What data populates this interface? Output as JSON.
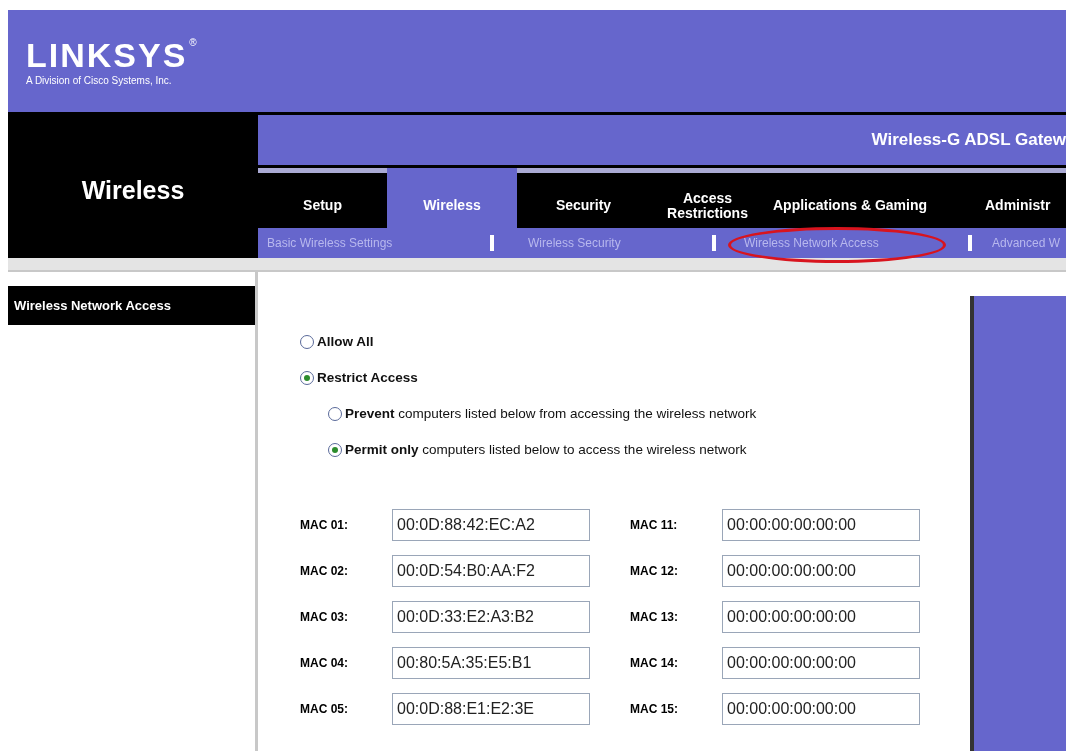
{
  "logo": {
    "brand": "LINKSYS",
    "mark": "®",
    "tagline": "A Division of Cisco Systems, Inc."
  },
  "section_title": "Wireless",
  "product_name": "Wireless-G ADSL Gatew",
  "tabs": [
    {
      "label": "Setup",
      "selected": false
    },
    {
      "label": "Wireless",
      "selected": true
    },
    {
      "label": "Security",
      "selected": false
    },
    {
      "label": "Access Restrictions",
      "selected": false
    },
    {
      "label": "Applications & Gaming",
      "selected": false
    },
    {
      "label": "Administr",
      "selected": false
    }
  ],
  "sub_tabs": [
    {
      "label": "Basic Wireless Settings",
      "circled": false
    },
    {
      "label": "Wireless Security",
      "circled": false
    },
    {
      "label": "Wireless Network Access",
      "circled": true
    },
    {
      "label": "Advanced W",
      "circled": false
    }
  ],
  "sidebar_heading": "Wireless Network Access",
  "access_mode": [
    {
      "label": "Allow All",
      "selected": false
    },
    {
      "label": "Restrict Access",
      "selected": true
    }
  ],
  "restrict_mode": [
    {
      "label": "**Prevent** computers listed below from accessing the wireless network",
      "selected": false
    },
    {
      "label": "**Permit only** computers listed below to access the wireless network",
      "selected": true
    }
  ],
  "mac_table": [
    {
      "label": "MAC 01:",
      "value": "00:0D:88:42:EC:A2"
    },
    {
      "label": "MAC 11:",
      "value": "00:00:00:00:00:00"
    },
    {
      "label": "MAC 02:",
      "value": "00:0D:54:B0:AA:F2"
    },
    {
      "label": "MAC 12:",
      "value": "00:00:00:00:00:00"
    },
    {
      "label": "MAC 03:",
      "value": "00:0D:33:E2:A3:B2"
    },
    {
      "label": "MAC 13:",
      "value": "00:00:00:00:00:00"
    },
    {
      "label": "MAC 04:",
      "value": "00:80:5A:35:E5:B1"
    },
    {
      "label": "MAC 14:",
      "value": "00:00:00:00:00:00"
    },
    {
      "label": "MAC 05:",
      "value": "00:0D:88:E1:E2:3E"
    },
    {
      "label": "MAC 15:",
      "value": "00:00:00:00:00:00"
    }
  ]
}
